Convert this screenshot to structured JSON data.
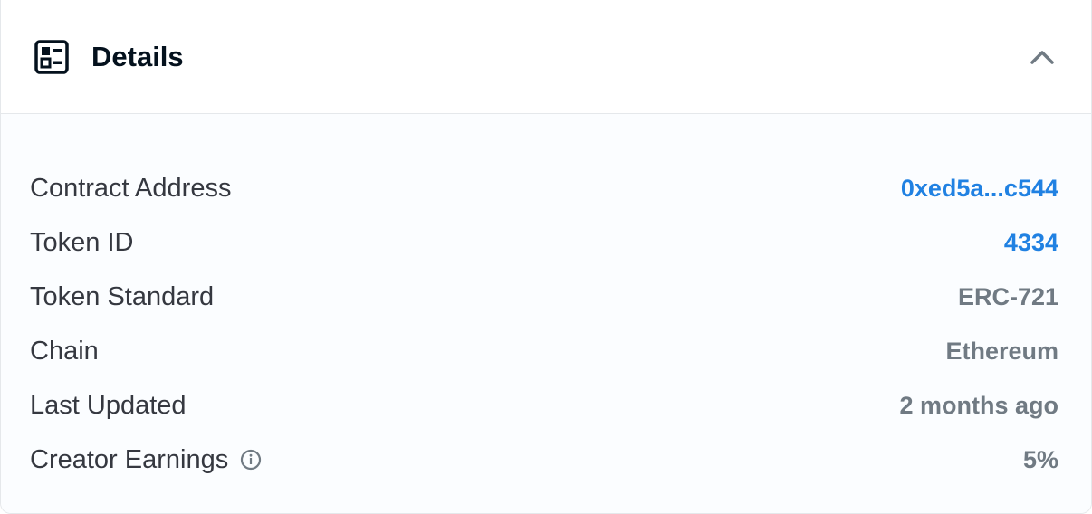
{
  "header": {
    "title": "Details",
    "icon": "details-list-icon",
    "toggle_icon": "chevron-up-icon"
  },
  "colors": {
    "link": "#2081e2",
    "label": "#353840",
    "value": "#707a83",
    "title": "#04111d"
  },
  "details": {
    "contract_address": {
      "label": "Contract Address",
      "value": "0xed5a...c544"
    },
    "token_id": {
      "label": "Token ID",
      "value": "4334"
    },
    "token_standard": {
      "label": "Token Standard",
      "value": "ERC-721"
    },
    "chain": {
      "label": "Chain",
      "value": "Ethereum"
    },
    "last_updated": {
      "label": "Last Updated",
      "value": "2 months ago"
    },
    "creator_earnings": {
      "label": "Creator Earnings",
      "value": "5%",
      "info_icon": "info-icon"
    }
  }
}
